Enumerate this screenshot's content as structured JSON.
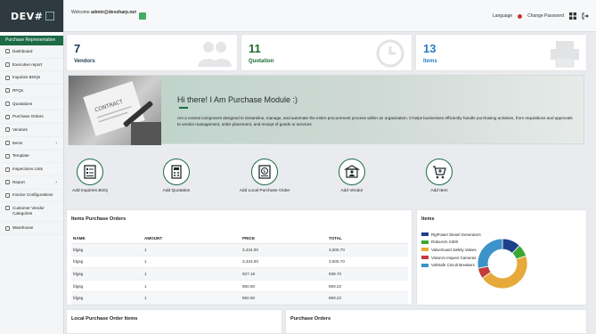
{
  "brand": {
    "logo_text": "DEV#"
  },
  "sidebar": {
    "role": "Purchase Representative",
    "items": [
      {
        "label": "Dashboard",
        "icon": "dashboard-icon",
        "caret": ""
      },
      {
        "label": "Executive report",
        "icon": "report-icon",
        "caret": ""
      },
      {
        "label": "Inquiries BOQs",
        "icon": "inbox-icon",
        "caret": ""
      },
      {
        "label": "RFQs",
        "icon": "rfq-icon",
        "caret": ""
      },
      {
        "label": "Quotations",
        "icon": "quote-icon",
        "caret": ""
      },
      {
        "label": "Purchase Orders",
        "icon": "cart-icon",
        "caret": ""
      },
      {
        "label": "Vendors",
        "icon": "vendor-icon",
        "caret": ""
      },
      {
        "label": "Items",
        "icon": "items-icon",
        "caret": "›"
      },
      {
        "label": "Template",
        "icon": "template-icon",
        "caret": ""
      },
      {
        "label": "Inspections Lists",
        "icon": "list-icon",
        "caret": ""
      },
      {
        "label": "Report",
        "icon": "chart-icon",
        "caret": "›"
      },
      {
        "label": "Invoice Configurations",
        "icon": "gear-icon",
        "caret": ""
      },
      {
        "label": "Customer Vendor Categories",
        "icon": "gear-icon",
        "caret": ""
      },
      {
        "label": "Warehouse",
        "icon": "warehouse-icon",
        "caret": ""
      }
    ]
  },
  "header": {
    "welcome_prefix": "Welcome",
    "user": "admin@devsharp.net",
    "language_label": "Language",
    "change_password_label": "Change Password"
  },
  "stats": [
    {
      "value": "7",
      "label": "Vendors",
      "color": "#1f3b4d"
    },
    {
      "value": "11",
      "label": "Quotation",
      "color": "#1c6b2e"
    },
    {
      "value": "13",
      "label": "Items",
      "color": "#2b7bc0"
    }
  ],
  "hero": {
    "title": "Hi there! I Am Purchase Module :)",
    "description": "Am a central component designed to streamline, manage, and automate the entire procurement process within an organization. It helps businesses efficiently handle purchasing activities, from requisitions and approvals to vendor management, order placement, and receipt of goods or services.",
    "image_caption": "CONTRACT"
  },
  "quick_actions": [
    {
      "label": "Add Inquiries BOQ",
      "icon": "boq-icon"
    },
    {
      "label": "Add Quotation",
      "icon": "quotation-icon"
    },
    {
      "label": "Add Local Purchase Order",
      "icon": "money-icon"
    },
    {
      "label": "Add Vendor",
      "icon": "vendor-add-icon"
    },
    {
      "label": "Add Item",
      "icon": "cart-add-icon"
    }
  ],
  "items_purchase_orders": {
    "title": "Items Purchase Orders",
    "columns": [
      "NAME",
      "AMOUNT",
      "PRICE",
      "TOTAL"
    ],
    "rows": [
      [
        "fdgsg",
        "1",
        "3,434.00",
        "3,605.70"
      ],
      [
        "fdgsg",
        "1",
        "3,434.00",
        "3,605.70"
      ],
      [
        "fdgsg",
        "1",
        "927.18",
        "939.70"
      ],
      [
        "fdgsg",
        "1",
        "850.50",
        "869.22"
      ],
      [
        "fdgsg",
        "1",
        "850.50",
        "869.22"
      ]
    ]
  },
  "items_chart": {
    "title": "Items"
  },
  "chart_data": {
    "type": "pie",
    "title": "Items",
    "categories": [
      "RigPower Diesel Generators",
      "RoboArm X300",
      "ValveGuard Safety Valves",
      "VisionAI Inspect Cameras",
      "VoltSafe Circuit Breakers"
    ],
    "values": [
      12,
      8,
      45,
      7,
      28
    ],
    "colors": [
      "#1e3f8a",
      "#3aa832",
      "#e6a93a",
      "#c23b3b",
      "#3b93c9"
    ]
  },
  "bottom_panels": {
    "local_po_title": "Local Purchase Order Items",
    "purchase_orders_title": "Purchase Orders"
  }
}
